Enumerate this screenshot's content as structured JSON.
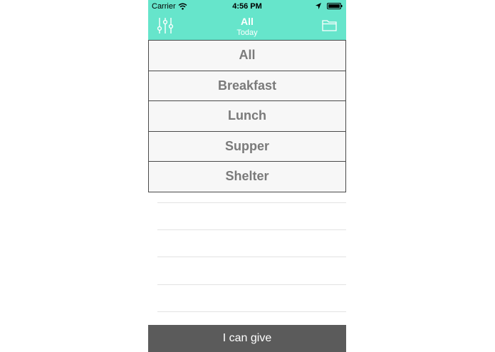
{
  "status_bar": {
    "carrier": "Carrier",
    "time": "4:56 PM"
  },
  "nav": {
    "title": "All",
    "subtitle": "Today",
    "filter_icon": "sliders-icon",
    "folder_icon": "folder-icon"
  },
  "menu": {
    "items": [
      "All",
      "Breakfast",
      "Lunch",
      "Supper",
      "Shelter"
    ]
  },
  "footer": {
    "button_label": "I can give"
  },
  "colors": {
    "header": "#66e5cb",
    "button": "#5b5b5b",
    "menu_bg": "#f7f7f7",
    "menu_text": "#7a7a7a"
  }
}
